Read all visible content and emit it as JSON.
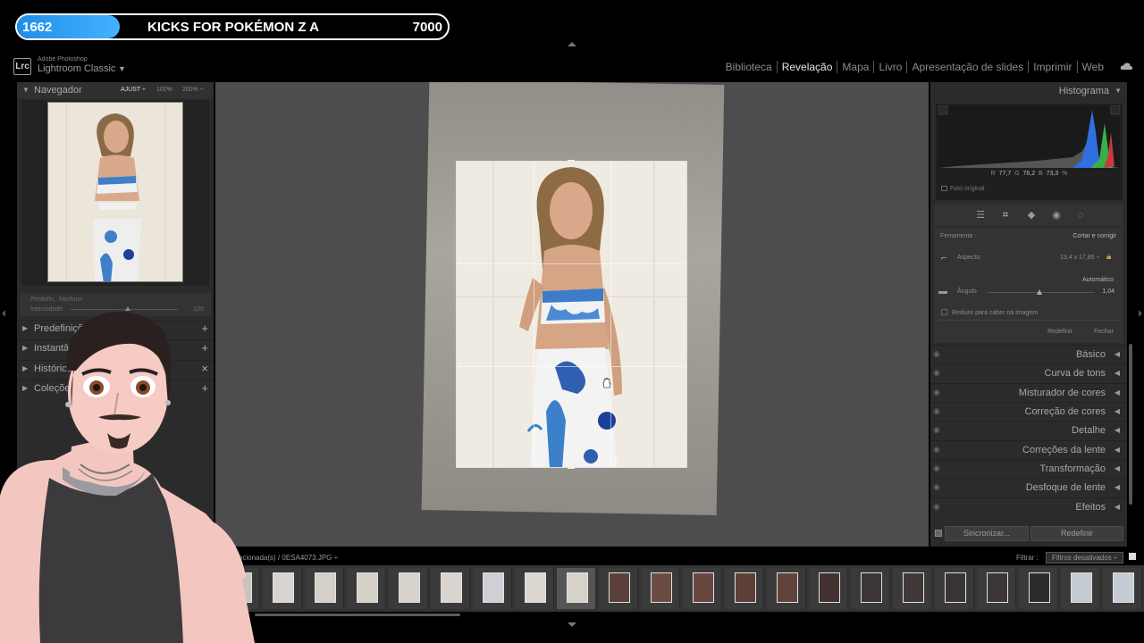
{
  "stream": {
    "count": "1662",
    "title": "KICKS FOR POKÉMON Z A",
    "goal": "7000"
  },
  "app": {
    "logo": "Lrc",
    "brand_small": "Adobe Photoshop",
    "brand_name": "Lightroom Classic",
    "brand_caret": "▼"
  },
  "modules": [
    "Biblioteca",
    "Revelação",
    "Mapa",
    "Livro",
    "Apresentação de slides",
    "Imprimir",
    "Web"
  ],
  "active_module": "Revelação",
  "left_panel": {
    "navigator": {
      "title": "Navegador",
      "zoom": [
        "AJUST ÷",
        "100%",
        "200% ÷"
      ]
    },
    "preset": {
      "line1": "Predefin.: Nenhum",
      "line2": "Intensidade",
      "value": "100"
    },
    "sections": [
      {
        "label": "Predefinições",
        "action": "+"
      },
      {
        "label": "Instantâneos",
        "action": "+"
      },
      {
        "label": "Histórico",
        "action": "×"
      },
      {
        "label": "Coleções",
        "action": "+"
      }
    ]
  },
  "histogram": {
    "title": "Histograma",
    "r_label": "R",
    "r_value": "77,7",
    "g_label": "G",
    "g_value": "76,2",
    "b_label": "B",
    "b_value": "73,3",
    "unit": "%",
    "original_photo": "Foto original"
  },
  "crop_tool": {
    "tool_label": "Ferramenta :",
    "tool_name": "Cortar e corrigir",
    "aspect_label": "Aspecto:",
    "aspect_value": "13,4 x 17,85 ÷",
    "auto_label": "Automático",
    "angle_label": "Ângulo",
    "angle_value": "1,04",
    "constrain_label": "Reduzir para caber na imagem",
    "reset_label": "Redefinir",
    "close_label": "Fechar"
  },
  "right_sections": [
    "Básico",
    "Curva de tons",
    "Misturador de cores",
    "Correção de cores",
    "Detalhe",
    "Correções da lente",
    "Transformação",
    "Desfoque de lente",
    "Efeitos"
  ],
  "right_footer": {
    "sync_label": "Sincronizar...",
    "reset_label": "Redefinir"
  },
  "filmstrip": {
    "path": "4 selecionada(s) / 0ESA4073.JPG ÷",
    "filter_label": "Filtrar :",
    "filter_value": "Filtros desativados ÷",
    "thumb_colors": [
      "#c9c4bd",
      "#d8d4cf",
      "#d4cfc8",
      "#d5d0c8",
      "#d7d2cb",
      "#d9d4ce",
      "#cfd0d5",
      "#dcd7d0",
      "#d6d1c9",
      "#5a4039",
      "#6b4b42",
      "#67473f",
      "#5c4038",
      "#60443c",
      "#413231",
      "#3b3535",
      "#403837",
      "#3a3434",
      "#3c3636",
      "#2c2b2e",
      "#c5cbd2",
      "#c6ccd5"
    ],
    "selected_index": 8
  },
  "colors": {
    "accent": "#1f8ee8",
    "panel": "#2b2b2b",
    "canvas": "#4d4d4d"
  }
}
